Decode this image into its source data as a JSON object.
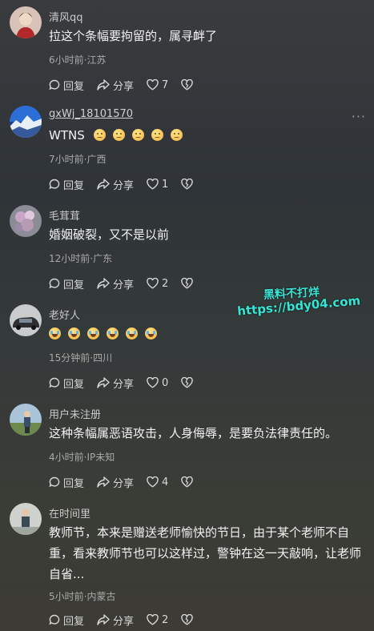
{
  "comments": [
    {
      "username": "清风qq",
      "text": "拉这个条幅要拘留的，属寻衅了",
      "meta": "6小时前·江苏",
      "reply": "回复",
      "share": "分享",
      "likes": "7"
    },
    {
      "username": "gxWj_18101570",
      "text": "WTNS",
      "meta": "7小时前·广西",
      "reply": "回复",
      "share": "分享",
      "likes": "1",
      "more": "···"
    },
    {
      "username": "毛茸茸",
      "text": "婚姻破裂，又不是以前",
      "meta": "12小时前·广东",
      "reply": "回复",
      "share": "分享",
      "likes": "2"
    },
    {
      "username": "老好人",
      "text": "",
      "meta": "15分钟前·四川",
      "reply": "回复",
      "share": "分享",
      "likes": "0"
    },
    {
      "username": "用户未注册",
      "text": "这种条幅属恶语攻击，人身侮辱，是要负法律责任的。",
      "meta": "4小时前·IP未知",
      "reply": "回复",
      "share": "分享",
      "likes": "4"
    },
    {
      "username": "在时间里",
      "text": "教师节，本来是赠送老师愉快的节日，由于某个老师不自重，看来教师节也可以这样过，警钟在这一天敲响，让老师自省...",
      "meta": "5小时前·内蒙古",
      "reply": "回复",
      "share": "分享",
      "likes": "2"
    }
  ],
  "watermark": {
    "line1": "黑料不打烊",
    "line2": "https://bdy04.com"
  },
  "colors": {
    "background": "#34393a",
    "watermark": "#35e6d5"
  }
}
